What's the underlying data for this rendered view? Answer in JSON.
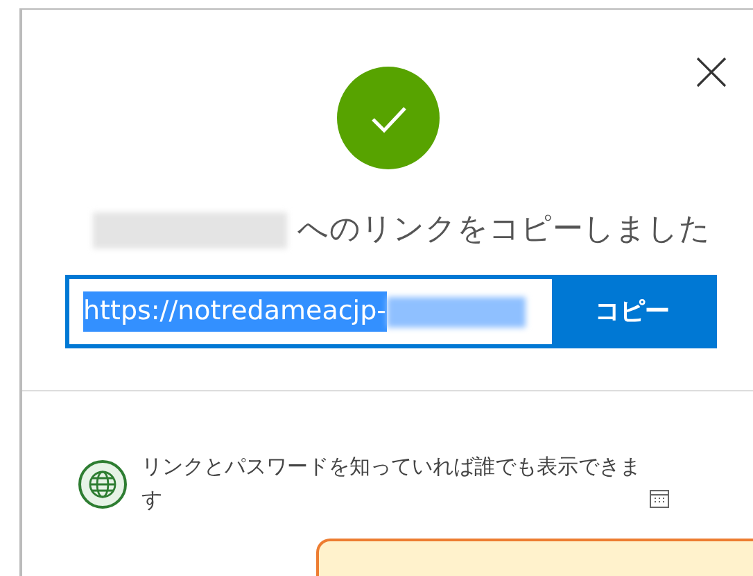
{
  "dialog": {
    "title": "へのリンクをコピーしました",
    "link_field": {
      "value": "https://notredameacjp-"
    },
    "copy_button": "コピー",
    "permission": "リンクとパスワードを知っていれば誰でも表示できます"
  },
  "callout": {
    "kind": "note"
  }
}
